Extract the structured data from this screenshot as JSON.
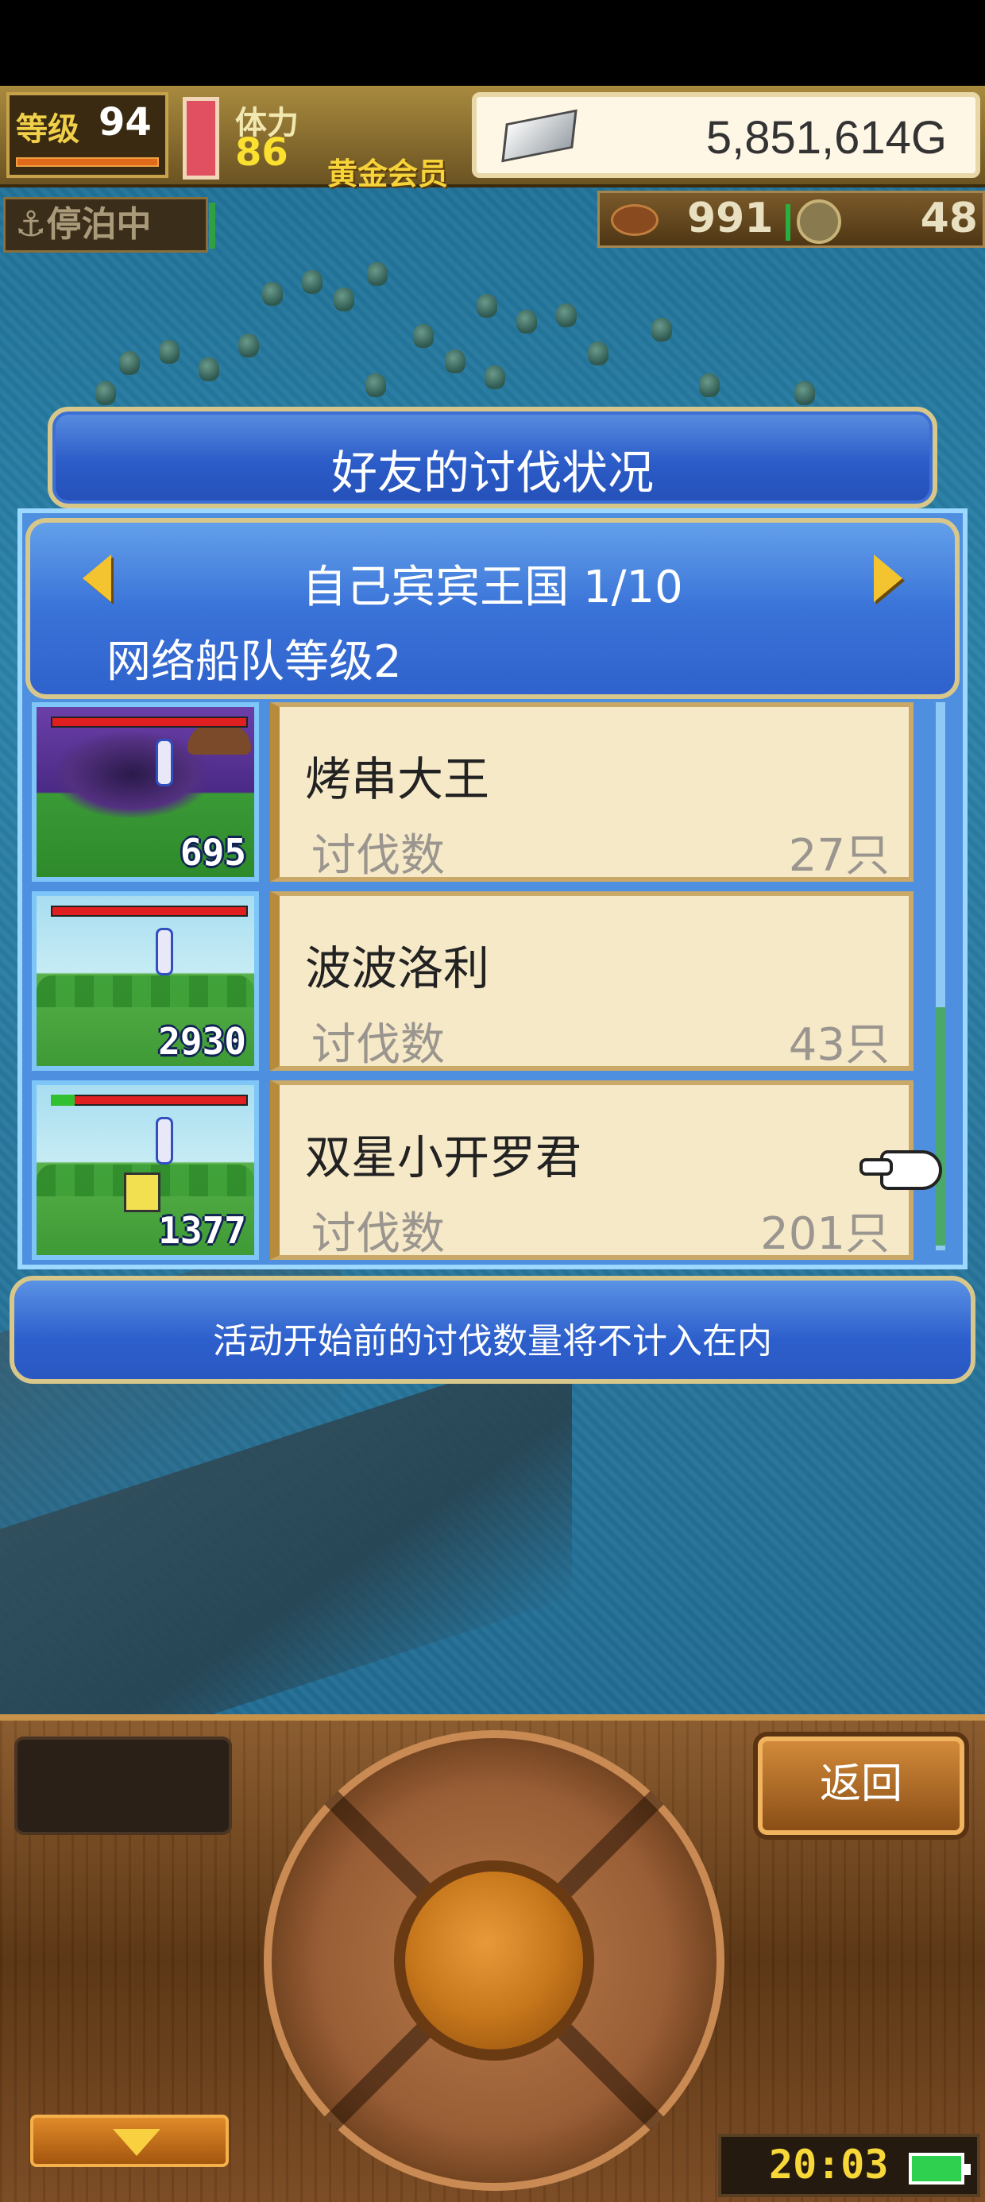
{
  "hud": {
    "level_label": "等级",
    "level": "94",
    "stamina_label": "体力",
    "stamina": "86",
    "membership": "黄金会员",
    "money": "5,851,614G",
    "status": "停泊中",
    "food": "991",
    "medals": "48"
  },
  "dialog": {
    "title": "好友的讨伐状况",
    "kingdom": "自己宾宾王国 1/10",
    "fleet_level": "网络船队等级2",
    "notice": "活动开始前的讨伐数量将不计入在内"
  },
  "friends": [
    {
      "name": "烤串大王",
      "kills_label": "讨伐数",
      "kills": "27只",
      "monster_level": "695"
    },
    {
      "name": "波波洛利",
      "kills_label": "讨伐数",
      "kills": "43只",
      "monster_level": "2930"
    },
    {
      "name": "双星小开罗君",
      "kills_label": "讨伐数",
      "kills": "201只",
      "monster_level": "1377"
    }
  ],
  "controls": {
    "back": "返回",
    "clock": "20:03"
  }
}
